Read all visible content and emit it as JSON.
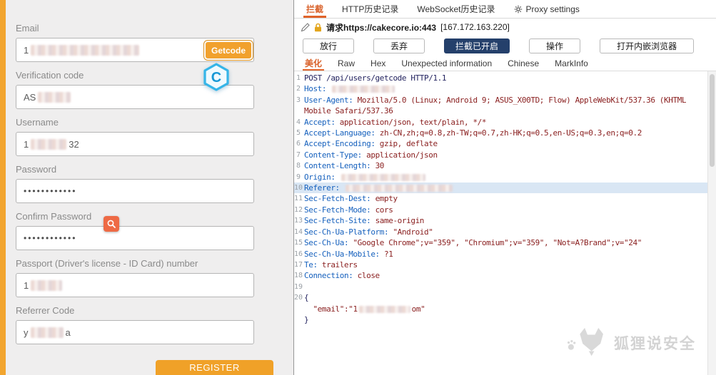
{
  "left_form": {
    "fields": [
      {
        "name": "email",
        "label": "Email",
        "prefix": "1",
        "redact_w": 152,
        "button": "Getcode"
      },
      {
        "name": "verification-code",
        "label": "Verification code",
        "prefix": "AS",
        "redact_w": 46
      },
      {
        "name": "username",
        "label": "Username",
        "prefix": "1",
        "redact_w": 50,
        "suffix": "32"
      },
      {
        "name": "password",
        "label": "Password",
        "dots": "••••••••••••"
      },
      {
        "name": "confirm-password",
        "label": "Confirm Password",
        "dots": "••••••••••••"
      },
      {
        "name": "passport-number",
        "label": "Passport (Driver's license - ID Card) number",
        "prefix": "1",
        "redact_w": 44
      },
      {
        "name": "referrer-code",
        "label": "Referrer Code",
        "prefix": "y",
        "redact_w": 46,
        "suffix": "a"
      }
    ],
    "register_label": "REGISTER",
    "logo_letter": "C"
  },
  "proxy": {
    "top_tabs": [
      {
        "key": "intercept",
        "label": "拦截",
        "active": true
      },
      {
        "key": "http-history",
        "label": "HTTP历史记录"
      },
      {
        "key": "websocket-history",
        "label": "WebSocket历史记录"
      },
      {
        "key": "proxy-settings",
        "label": "Proxy settings",
        "icon": "gear-icon"
      }
    ],
    "request_bar": {
      "prefix": "请求",
      "url": "https://cakecore.io:443",
      "ip": "[167.172.163.220]"
    },
    "action_buttons": [
      {
        "key": "forward",
        "label": "放行"
      },
      {
        "key": "drop",
        "label": "丢弃"
      },
      {
        "key": "intercept-toggle",
        "label": "拦截已开启",
        "primary": true
      },
      {
        "key": "action",
        "label": "操作"
      },
      {
        "key": "open-embedded-browser",
        "label": "打开内嵌浏览器"
      }
    ],
    "view_tabs": [
      {
        "key": "pretty",
        "label": "美化",
        "active": true
      },
      {
        "key": "raw",
        "label": "Raw"
      },
      {
        "key": "hex",
        "label": "Hex"
      },
      {
        "key": "unexpected-information",
        "label": "Unexpected information"
      },
      {
        "key": "chinese",
        "label": "Chinese"
      },
      {
        "key": "markinfo",
        "label": "MarkInfo"
      }
    ],
    "http_lines": [
      {
        "n": "1",
        "parts": [
          {
            "t": "POST /api/users/getcode HTTP/1.1",
            "c": "plain"
          }
        ]
      },
      {
        "n": "2",
        "parts": [
          {
            "t": "Host: ",
            "c": "name"
          },
          {
            "r": 88
          }
        ]
      },
      {
        "n": "3",
        "parts": [
          {
            "t": "User-Agent: ",
            "c": "name"
          },
          {
            "t": "Mozilla/5.0 (Linux; Android 9; ASUS_X00TD; Flow) AppleWebKit/537.36 (KHTML",
            "c": "value"
          }
        ]
      },
      {
        "n": "",
        "parts": [
          {
            "t": "Mobile Safari/537.36",
            "c": "value"
          }
        ]
      },
      {
        "n": "4",
        "parts": [
          {
            "t": "Accept: ",
            "c": "name"
          },
          {
            "t": "application/json, text/plain, */*",
            "c": "value"
          }
        ]
      },
      {
        "n": "5",
        "parts": [
          {
            "t": "Accept-Language: ",
            "c": "name"
          },
          {
            "t": "zh-CN,zh;q=0.8,zh-TW;q=0.7,zh-HK;q=0.5,en-US;q=0.3,en;q=0.2",
            "c": "value"
          }
        ]
      },
      {
        "n": "6",
        "parts": [
          {
            "t": "Accept-Encoding: ",
            "c": "name"
          },
          {
            "t": "gzip, deflate",
            "c": "value"
          }
        ]
      },
      {
        "n": "7",
        "parts": [
          {
            "t": "Content-Type: ",
            "c": "name"
          },
          {
            "t": "application/json",
            "c": "value"
          }
        ]
      },
      {
        "n": "8",
        "parts": [
          {
            "t": "Content-Length: ",
            "c": "name"
          },
          {
            "t": "30",
            "c": "value"
          }
        ]
      },
      {
        "n": "9",
        "parts": [
          {
            "t": "Origin: ",
            "c": "name"
          },
          {
            "r": 118
          }
        ]
      },
      {
        "n": "10",
        "hl": true,
        "parts": [
          {
            "t": "Referer: ",
            "c": "name"
          },
          {
            "r": 150
          }
        ]
      },
      {
        "n": "11",
        "parts": [
          {
            "t": "Sec-Fetch-Dest: ",
            "c": "name"
          },
          {
            "t": "empty",
            "c": "value"
          }
        ]
      },
      {
        "n": "12",
        "parts": [
          {
            "t": "Sec-Fetch-Mode: ",
            "c": "name"
          },
          {
            "t": "cors",
            "c": "value"
          }
        ]
      },
      {
        "n": "13",
        "parts": [
          {
            "t": "Sec-Fetch-Site: ",
            "c": "name"
          },
          {
            "t": "same-origin",
            "c": "value"
          }
        ]
      },
      {
        "n": "14",
        "parts": [
          {
            "t": "Sec-Ch-Ua-Platform: ",
            "c": "name"
          },
          {
            "t": "\"Android\"",
            "c": "value"
          }
        ]
      },
      {
        "n": "15",
        "parts": [
          {
            "t": "Sec-Ch-Ua: ",
            "c": "name"
          },
          {
            "t": "\"Google Chrome\";v=\"359\", \"Chromium\";v=\"359\", \"Not=A?Brand\";v=\"24\"",
            "c": "value"
          }
        ]
      },
      {
        "n": "16",
        "parts": [
          {
            "t": "Sec-Ch-Ua-Mobile: ",
            "c": "name"
          },
          {
            "t": "?1",
            "c": "value"
          }
        ]
      },
      {
        "n": "17",
        "parts": [
          {
            "t": "Te: ",
            "c": "name"
          },
          {
            "t": "trailers",
            "c": "value"
          }
        ]
      },
      {
        "n": "18",
        "parts": [
          {
            "t": "Connection: ",
            "c": "name"
          },
          {
            "t": "close",
            "c": "value"
          }
        ]
      },
      {
        "n": "19",
        "parts": []
      },
      {
        "n": "20",
        "parts": [
          {
            "t": "{",
            "c": "plain"
          }
        ]
      },
      {
        "n": "",
        "parts": [
          {
            "t": "  \"email\":\"1",
            "c": "value"
          },
          {
            "r": 72
          },
          {
            "t": "om\"",
            "c": "value"
          }
        ]
      },
      {
        "n": "",
        "parts": [
          {
            "t": "}",
            "c": "plain"
          }
        ]
      }
    ]
  },
  "watermark": {
    "text": "狐狸说安全"
  },
  "colors": {
    "accent_orange": "#f2a52f",
    "tab_active_orange": "#e0632a",
    "intercept_button_navy": "#24406b",
    "header_name_blue": "#1560bd",
    "header_value_red": "#8b2121",
    "highlight_row": "#d9e6f4"
  }
}
